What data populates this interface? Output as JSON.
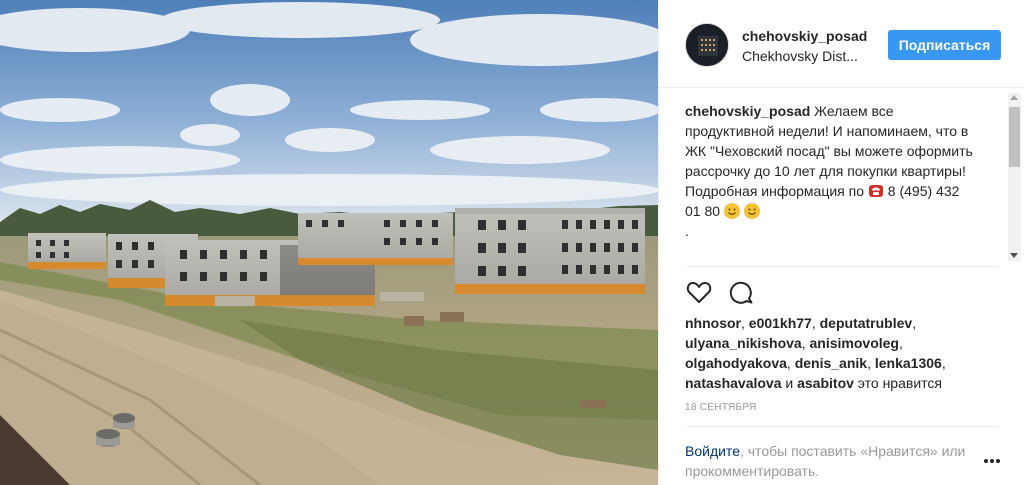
{
  "post": {
    "username": "chehovskiy_posad",
    "location": "Chekhovsky Dist...",
    "follow_label": "Подписаться"
  },
  "caption": {
    "username": "chehovskiy_posad",
    "text_before_phone": " Желаем все продуктивной недели! И напоминаем, что в ЖК \"Чеховский посад\" вы можете оформить рассрочку до 10 лет для покупки квартиры! Подробная информация по ",
    "phone": " 8 (495) 432 01 80 ",
    "trailing": "."
  },
  "likes": {
    "users": [
      "nhnosor",
      "e001kh77",
      "deputatrublev",
      "ulyana_nikishova",
      "anisimovoleg",
      "olgahodyakova",
      "denis_anik",
      "lenka1306",
      "natashavalova"
    ],
    "last_user": "asabitov",
    "connector": " и ",
    "suffix": " это нравится"
  },
  "date": "18 СЕНТЯБРЯ",
  "login": {
    "link": "Войдите",
    "text": ", чтобы поставить «Нравится» или прокомментировать."
  },
  "icons": {
    "like": "heart-outline-icon",
    "comment": "comment-bubble-icon",
    "more": "more-dots-icon",
    "phone": "telephone-emoji-icon",
    "smile": "smiling-face-emoji-icon"
  },
  "colors": {
    "follow_button": "#3897f0",
    "link": "#003569",
    "muted": "#999999",
    "text": "#262626"
  }
}
